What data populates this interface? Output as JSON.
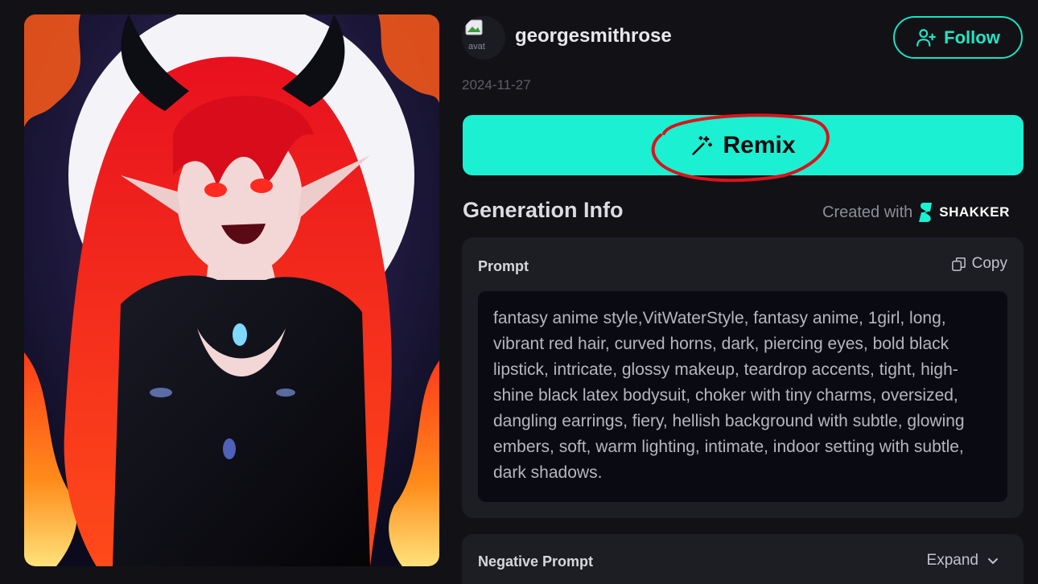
{
  "artwork": {
    "icon": "artwork-image"
  },
  "author": {
    "username": "georgesmithrose",
    "avatar_alt": "avat",
    "date": "2024-11-27",
    "follow_label": "Follow",
    "follow_icon": "user-plus-icon"
  },
  "remix": {
    "label": "Remix",
    "icon": "magic-wand-icon"
  },
  "generation": {
    "title": "Generation Info",
    "created_with": "Created with",
    "brand": "SHAKKER"
  },
  "prompt": {
    "label": "Prompt",
    "copy_label": "Copy",
    "text": "fantasy anime style,VitWaterStyle, fantasy anime, 1girl, long, vibrant red hair, curved horns, dark, piercing eyes, bold black lipstick, intricate, glossy makeup, teardrop accents, tight, high-shine black latex bodysuit, choker with tiny charms, oversized, dangling earrings, fiery, hellish background with subtle, glowing embers, soft, warm lighting, intimate, indoor setting with subtle, dark shadows."
  },
  "negative_prompt": {
    "label": "Negative Prompt",
    "expand_label": "Expand"
  },
  "colors": {
    "accent": "#1cf0d2",
    "background": "#121216",
    "card": "#1d1d24",
    "annotation": "#d8141c"
  }
}
